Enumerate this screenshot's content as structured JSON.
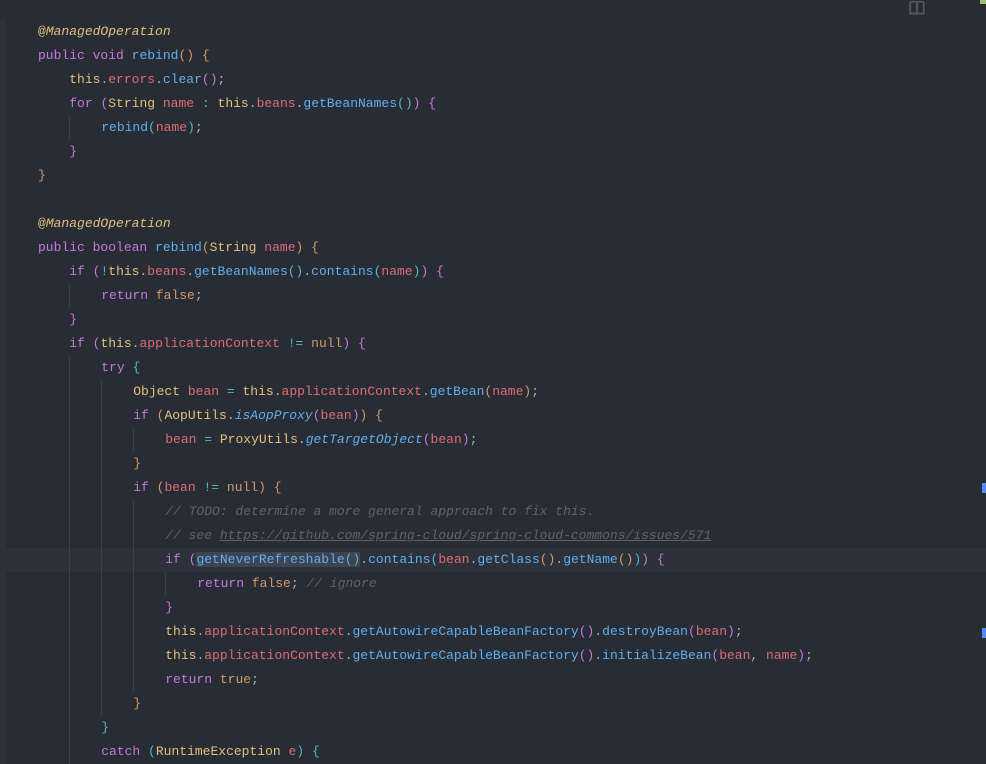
{
  "code": {
    "annot_managed": "ManagedOperation",
    "kw_public": "public",
    "kw_void": "void",
    "kw_boolean": "boolean",
    "kw_for": "for",
    "kw_if": "if",
    "kw_try": "try",
    "kw_catch": "catch",
    "kw_return": "return",
    "kw_this": "this",
    "kw_null": "null",
    "kw_false": "false",
    "kw_true": "true",
    "type_string": "String",
    "type_object": "Object",
    "type_runtime": "RuntimeException",
    "fn_rebind": "rebind",
    "fn_clear": "clear",
    "fn_getBeanNames": "getBeanNames",
    "fn_contains": "contains",
    "fn_getBean": "getBean",
    "fn_isAopProxy": "isAopProxy",
    "fn_getTargetObject": "getTargetObject",
    "fn_getNeverRefreshable": "getNeverRefreshable",
    "fn_getClass": "getClass",
    "fn_getName": "getName",
    "fn_getAutowire": "getAutowireCapableBeanFactory",
    "fn_destroyBean": "destroyBean",
    "fn_initializeBean": "initializeBean",
    "id_errors": "errors",
    "id_beans": "beans",
    "id_name": "name",
    "id_applicationContext": "applicationContext",
    "id_bean": "bean",
    "id_e": "e",
    "cls_AopUtils": "AopUtils",
    "cls_ProxyUtils": "ProxyUtils",
    "c_todo": "// TODO: determine a more general approach to fix this.",
    "c_see": "// see ",
    "c_link": "https://github.com/spring-cloud/spring-cloud-commons/issues/571",
    "c_ignore": "// ignore"
  }
}
